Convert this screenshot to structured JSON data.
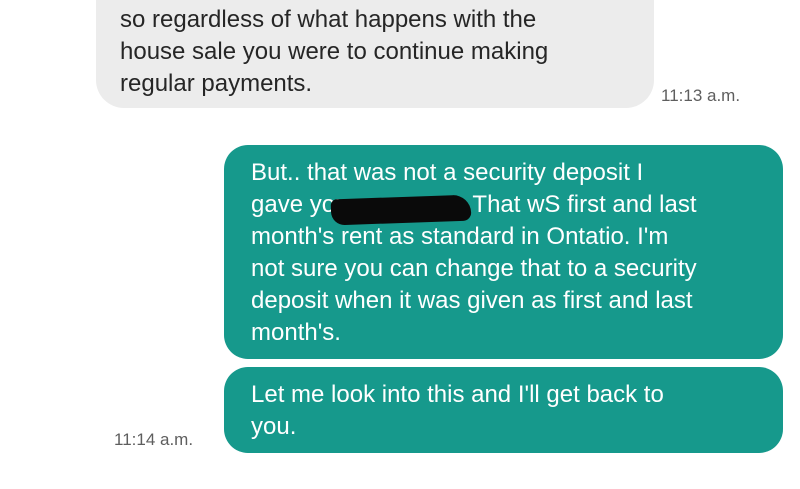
{
  "incoming_message": {
    "lines": [
      "so regardless of what happens with the",
      "house sale you were to continue making",
      "regular payments."
    ],
    "time": "11:13 a.m."
  },
  "outgoing_message_1": {
    "lines": [
      "But.. that was not a security deposit I",
      "gave you",
      "That wS first and last",
      "month's rent as standard in Ontatio. I'm",
      "not sure you can change that to a security",
      "deposit when it was given as first and last",
      "month's."
    ]
  },
  "outgoing_message_2": {
    "lines": [
      "Let me look into this and I'll get back to",
      "you."
    ],
    "time": "11:14 a.m."
  }
}
